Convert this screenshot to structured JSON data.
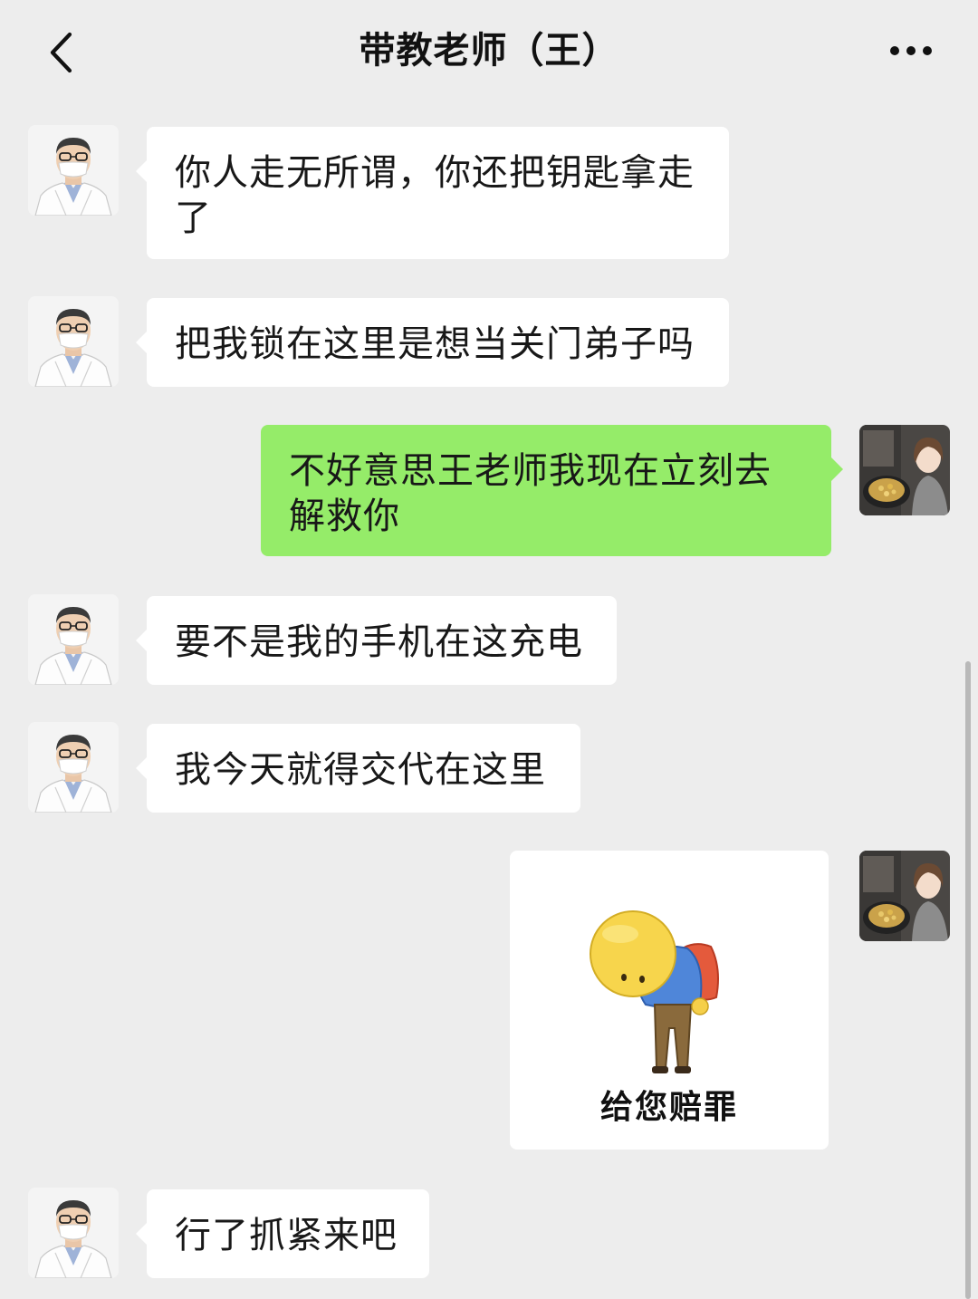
{
  "header": {
    "title": "带教老师（王）"
  },
  "messages": [
    {
      "from": "teacher",
      "text": "你人走无所谓，你还把钥匙拿走了"
    },
    {
      "from": "teacher",
      "text": "把我锁在这里是想当关门弟子吗"
    },
    {
      "from": "me",
      "text": "不好意思王老师我现在立刻去解救你"
    },
    {
      "from": "teacher",
      "text": "要不是我的手机在这充电"
    },
    {
      "from": "teacher",
      "text": "我今天就得交代在这里"
    },
    {
      "from": "me",
      "sticker_caption": "给您赔罪"
    },
    {
      "from": "teacher",
      "text": "行了抓紧来吧"
    }
  ],
  "colors": {
    "background": "#ededed",
    "incoming_bubble": "#ffffff",
    "outgoing_bubble": "#95ec69"
  },
  "icons": {
    "back": "chevron-left-icon",
    "more": "more-dots-icon"
  }
}
